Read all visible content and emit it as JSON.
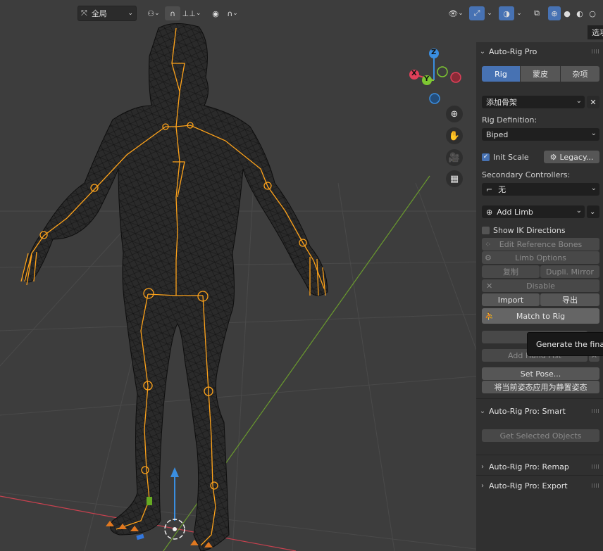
{
  "header": {
    "transform_orientation": "全局",
    "tab_label": "选项"
  },
  "gizmo": {
    "z": "Z",
    "x": "X",
    "y": "Y"
  },
  "panel": {
    "title": "Auto-Rig Pro",
    "tabs": [
      "Rig",
      "蒙皮",
      "杂项"
    ],
    "add_armature": "添加骨架",
    "rig_definition_label": "Rig Definition:",
    "rig_definition_value": "Biped",
    "init_scale_label": "Init Scale",
    "legacy_label": "Legacy...",
    "secondary_label": "Secondary Controllers:",
    "secondary_value": "无",
    "add_limb_label": "Add Limb",
    "show_ik_label": "Show IK Directions",
    "edit_ref_label": "Edit Reference Bones",
    "limb_options_label": "Limb Options",
    "copy_label": "复制",
    "dupli_mirror_label": "Dupli. Mirror",
    "disable_label": "Disable",
    "import_label": "Import",
    "export_label": "导出",
    "match_label": "Match to Rig",
    "edit_label": "Edit",
    "add_hand_fist_label": "Add Hand Fist",
    "set_pose_label": "Set Pose...",
    "apply_pose_label": "将当前姿态应用为静置姿态"
  },
  "tooltip": {
    "text": "Generate the final r"
  },
  "sections": {
    "smart": "Auto-Rig Pro: Smart",
    "get_selected": "Get Selected Objects",
    "remap": "Auto-Rig Pro: Remap",
    "export": "Auto-Rig Pro: Export"
  },
  "colors": {
    "accent": "#4772b3",
    "bone": "#ffa31a",
    "axis_x": "#e0405a",
    "axis_y": "#7ec732",
    "axis_z": "#3a8ee0"
  }
}
